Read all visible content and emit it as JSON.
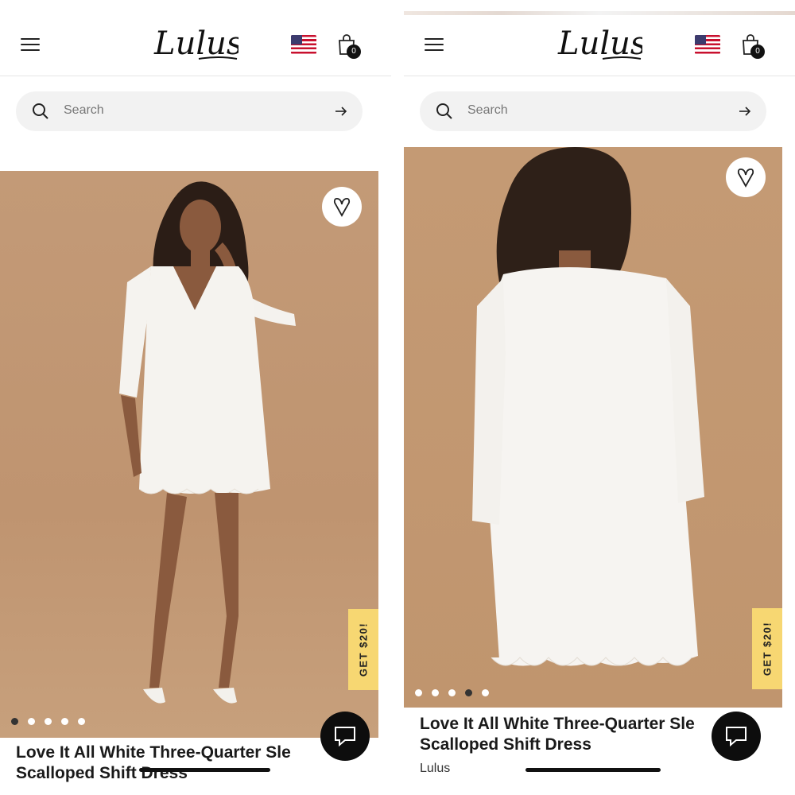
{
  "screens": [
    {
      "header": {
        "logo": "Lulus",
        "cart_count": "0"
      },
      "search": {
        "placeholder": "Search"
      },
      "product": {
        "promo": "GET $20!",
        "title_line1": "Love It All White Three-Quarter Sle",
        "title_line2": "Scalloped Shift Dress",
        "carousel": {
          "total": 5,
          "active": 0
        }
      }
    },
    {
      "header": {
        "logo": "Lulus",
        "cart_count": "0"
      },
      "search": {
        "placeholder": "Search"
      },
      "product": {
        "promo": "GET $20!",
        "title_line1": "Love It All White Three-Quarter Sle",
        "title_line2": "Scalloped Shift Dress",
        "brand": "Lulus",
        "carousel": {
          "total": 5,
          "active": 3
        }
      }
    }
  ],
  "icons": {
    "menu": "hamburger-icon",
    "flag": "us-flag-icon",
    "cart": "shopping-bag-icon",
    "search": "search-icon",
    "submit": "arrow-right-icon",
    "wishlist": "heart-icon",
    "chat": "chat-bubble-icon"
  },
  "colors": {
    "promo_tab": "#f7d772",
    "image_bg": "#c29874",
    "chat_button": "#0d0d0d"
  }
}
